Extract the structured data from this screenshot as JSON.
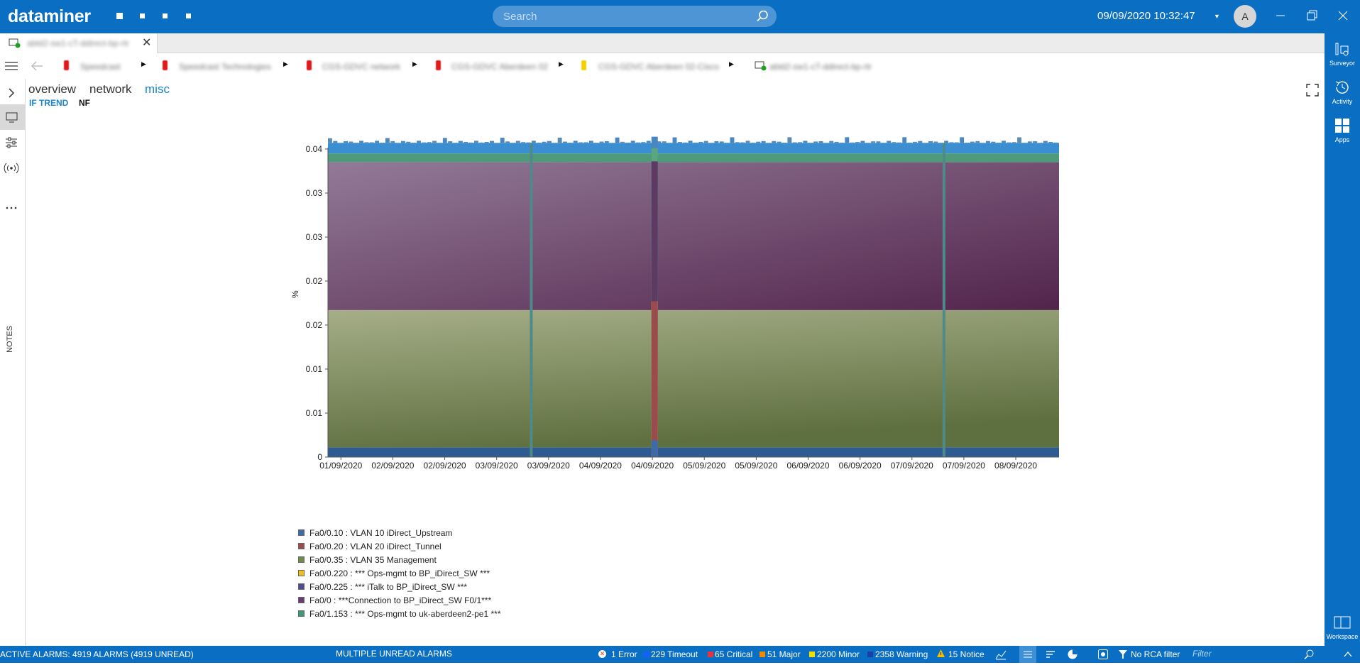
{
  "app": {
    "logo": "dataminer",
    "datetime": "09/09/2020 10:32:47",
    "user_initial": "A"
  },
  "search": {
    "placeholder": "Search"
  },
  "tab": {
    "label": "abld2-sw1-cT-ddirect-bp-rtr"
  },
  "breadcrumbs": [
    {
      "label": "Speedcast",
      "color": "#e0191b"
    },
    {
      "label": "Speedcast Technologies",
      "color": "#e0191b"
    },
    {
      "label": "CGS-GDVC network",
      "color": "#e0191b"
    },
    {
      "label": "CGS-GDVC Aberdeen 02",
      "color": "#e0191b"
    },
    {
      "label": "CGS-GDVC Aberdeen 02-Cisco",
      "color": "#f2d100"
    },
    {
      "label": "abld2-sw1-cT-ddirect-bp-rtr",
      "color": "#20a020"
    }
  ],
  "view_tabs": [
    {
      "label": "overview",
      "active": false
    },
    {
      "label": "network",
      "active": false
    },
    {
      "label": "misc",
      "active": true
    }
  ],
  "sub_tabs": [
    {
      "label": "IF TREND",
      "active": true
    },
    {
      "label": "NF",
      "active": false
    }
  ],
  "left_rail": {
    "notes_label": "NOTES"
  },
  "right_rail": {
    "surveyor": "Surveyor",
    "activity": "Activity",
    "apps": "Apps",
    "workspace": "Workspace"
  },
  "chart_data": {
    "type": "area",
    "stacked": true,
    "ylabel": "%",
    "ytick_labels": [
      "0",
      "0.01",
      "0.01",
      "0.02",
      "0.02",
      "0.03",
      "0.03",
      "0.04"
    ],
    "yticks": [
      0,
      0.005,
      0.01,
      0.015,
      0.02,
      0.025,
      0.03,
      0.035
    ],
    "ylim": [
      0,
      0.035
    ],
    "xlim": [
      0,
      8.45
    ],
    "xtick_labels": [
      "01/09/2020",
      "02/09/2020",
      "02/09/2020",
      "03/09/2020",
      "03/09/2020",
      "04/09/2020",
      "04/09/2020",
      "05/09/2020",
      "05/09/2020",
      "06/09/2020",
      "06/09/2020",
      "07/09/2020",
      "07/09/2020",
      "08/09/2020"
    ],
    "xtick_pos": [
      0.15,
      0.75,
      1.35,
      1.95,
      2.55,
      3.15,
      3.75,
      4.35,
      4.95,
      5.55,
      6.15,
      6.75,
      7.35,
      7.95
    ],
    "gaps": [
      2.35,
      3.78,
      7.12
    ],
    "spike": {
      "x": 3.78,
      "series_levels": [
        0.0019,
        0.0177,
        0.0177,
        0.0177,
        0.0177,
        0.0336,
        0.0351,
        0.0364
      ]
    },
    "series": [
      {
        "name": "Fa0/0.10 : VLAN 10 iDirect_Upstream",
        "value": 0.0011,
        "color": "#3e6aa8"
      },
      {
        "name": "Fa0/0.20 : VLAN 20 iDirect_Tunnel",
        "value": 0.0,
        "color": "#9a4c4c"
      },
      {
        "name": "Fa0/0.35 : VLAN 35 Management",
        "value": 0.0156,
        "color": "#6e8c4a"
      },
      {
        "name": "Fa0/0.220 : *** Ops-mgmt to BP_iDirect_SW ***",
        "value": 0.0,
        "color": "#f0c020"
      },
      {
        "name": "Fa0/0.225 : *** iTalk to BP_iDirect_SW ***",
        "value": 0.0,
        "color": "#4c4c92"
      },
      {
        "name": "Fa0/0 : ***Connection to BP_iDirect_SW F0/1***",
        "value": 0.0168,
        "color": "#6a3a72"
      },
      {
        "name": "Fa0/1.153 : *** Ops-mgmt to uk-aberdeen2-pe1 ***",
        "value": 0.001,
        "color": "#3c9a78"
      }
    ],
    "top_band": {
      "value": 0.0012,
      "color": "#3b8fd0"
    }
  },
  "status_bar": {
    "active_alarms": "ACTIVE ALARMS: 4919 ALARMS (4919 UNREAD)",
    "multiple": "MULTIPLE UNREAD ALARMS",
    "counts": [
      {
        "label": "1 Error",
        "color": "#e8333a"
      },
      {
        "label": "229 Timeout",
        "color": "#1560ff"
      },
      {
        "label": "65 Critical",
        "color": "#e8333a"
      },
      {
        "label": "51 Major",
        "color": "#f08a00"
      },
      {
        "label": "2200 Minor",
        "color": "#f0e000"
      },
      {
        "label": "2358 Warning",
        "color": "#1b3fa8"
      },
      {
        "label": "15 Notice",
        "color": "#f0c000"
      }
    ],
    "rca": "No RCA filter",
    "filter_placeholder": "Filter"
  }
}
